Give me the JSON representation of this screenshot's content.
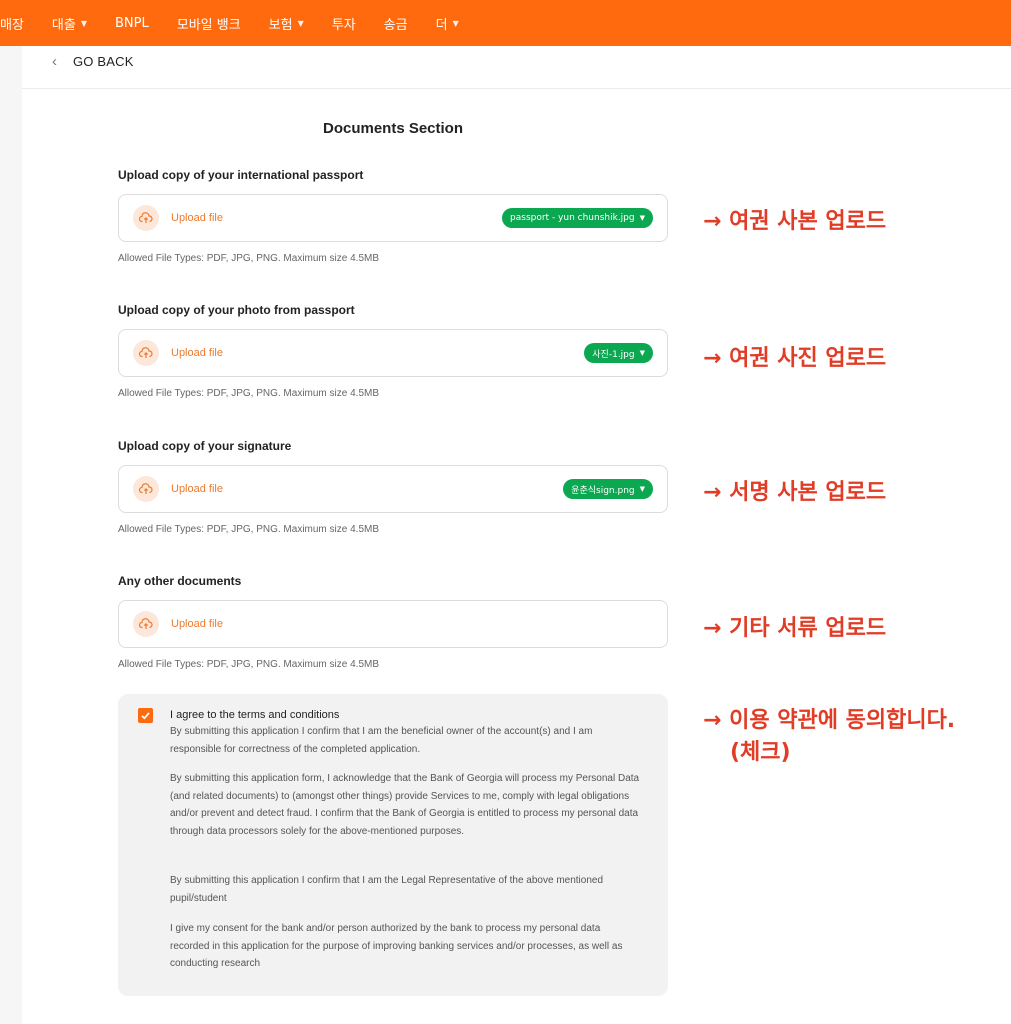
{
  "nav": {
    "items": [
      {
        "label": "매장",
        "chevron": false
      },
      {
        "label": "대출",
        "chevron": true
      },
      {
        "label": "BNPL",
        "chevron": false
      },
      {
        "label": "모바일 뱅크",
        "chevron": false
      },
      {
        "label": "보험",
        "chevron": true
      },
      {
        "label": "투자",
        "chevron": false
      },
      {
        "label": "송금",
        "chevron": false
      },
      {
        "label": "더",
        "chevron": true
      }
    ]
  },
  "back_label": "GO BACK",
  "section_title": "Documents Section",
  "upload_label": "Upload file",
  "help_text": "Allowed File Types: PDF, JPG, PNG. Maximum size 4.5MB",
  "fields": [
    {
      "label": "Upload copy of your international passport",
      "file": "passport - yun chunshik.jpg",
      "annotation": "→ 여권 사본 업로드"
    },
    {
      "label": "Upload copy of your photo from passport",
      "file": "사진-1.jpg",
      "annotation": "→ 여권 사진 업로드"
    },
    {
      "label": "Upload copy of your signature",
      "file": "윤춘식sign.png",
      "annotation": "→ 서명 사본 업로드"
    },
    {
      "label": "Any other documents",
      "file": "",
      "annotation": "→ 기타 서류 업로드"
    }
  ],
  "terms": {
    "checked": true,
    "title": "I agree to the terms and conditions",
    "paragraphs": [
      "By submitting this application I confirm that I am the beneficial owner of the account(s) and I am responsible for correctness of the completed application.",
      "By submitting this application form, I acknowledge that the Bank of Georgia will process my Personal Data (and related documents) to (amongst other things) provide Services to me, comply with legal obligations and/or prevent and detect fraud. I confirm that the Bank of Georgia is entitled to process my personal data through data processors solely for the above-mentioned purposes.",
      "By submitting this application I confirm that I am the Legal Representative of the above mentioned pupil/student",
      "I give my consent for the bank and/or person authorized by the bank to process my personal data recorded in this application for the purpose of improving banking services and/or processes, as well as conducting research"
    ],
    "annotation_line1": "→ 이용 약관에 동의합니다.",
    "annotation_line2": "(체크)"
  },
  "colors": {
    "brand_orange": "#ff6a0f",
    "chip_green": "#0ba751",
    "annotation_red": "#e03c26"
  }
}
